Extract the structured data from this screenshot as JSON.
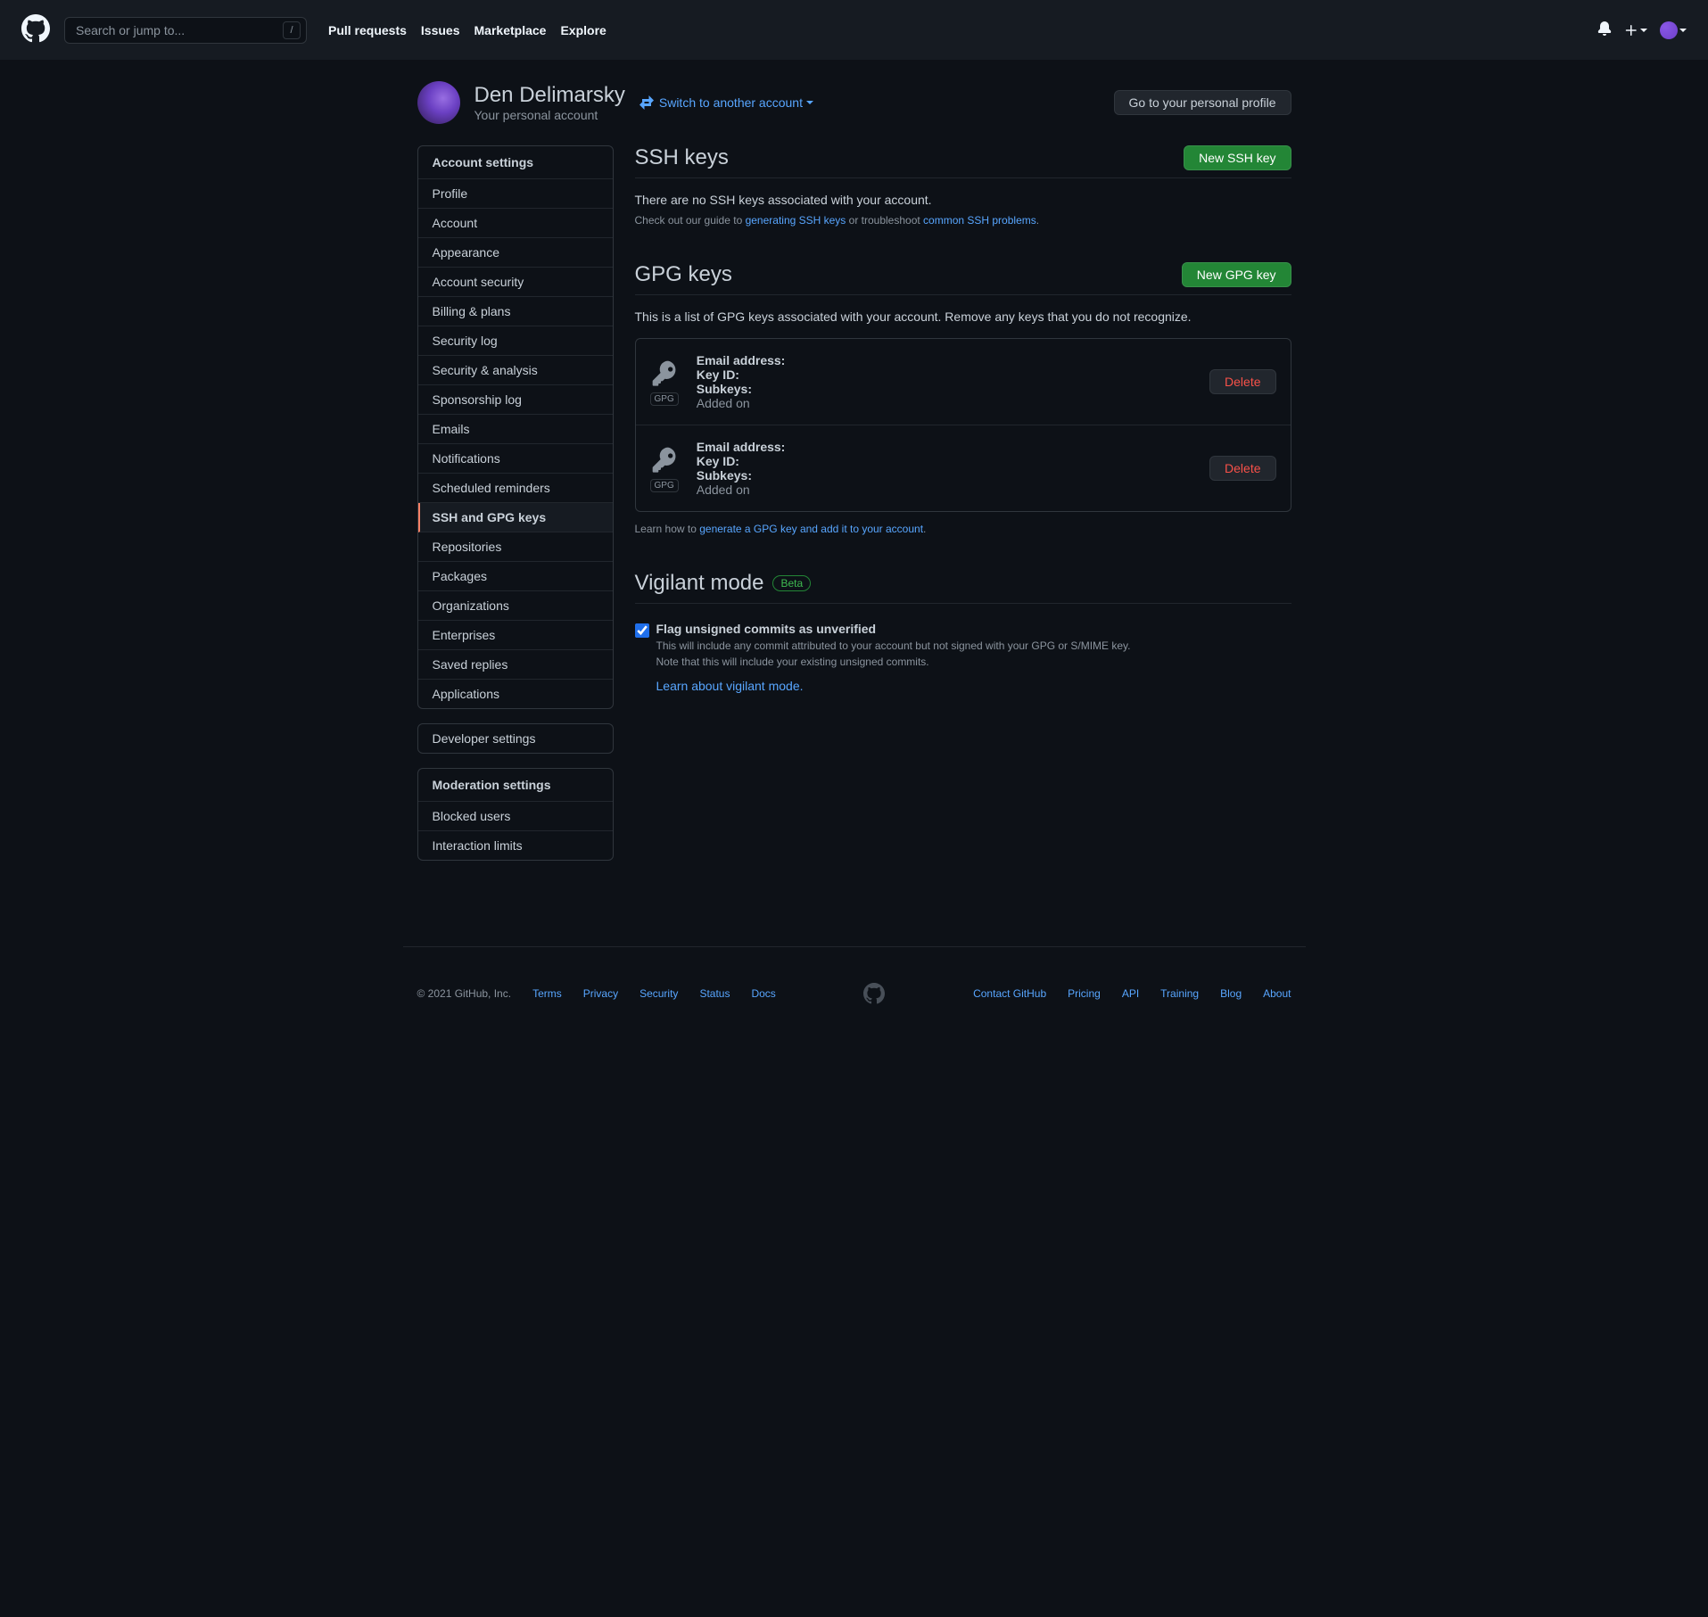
{
  "header": {
    "search_placeholder": "Search or jump to...",
    "nav": [
      "Pull requests",
      "Issues",
      "Marketplace",
      "Explore"
    ]
  },
  "profile": {
    "name": "Den Delimarsky",
    "subtitle": "Your personal account",
    "switch_label": "Switch to another account",
    "goto_label": "Go to your personal profile"
  },
  "sidebar": {
    "account_settings": {
      "heading": "Account settings",
      "items": [
        "Profile",
        "Account",
        "Appearance",
        "Account security",
        "Billing & plans",
        "Security log",
        "Security & analysis",
        "Sponsorship log",
        "Emails",
        "Notifications",
        "Scheduled reminders",
        "SSH and GPG keys",
        "Repositories",
        "Packages",
        "Organizations",
        "Enterprises",
        "Saved replies",
        "Applications"
      ],
      "active_index": 11
    },
    "developer": {
      "label": "Developer settings"
    },
    "moderation": {
      "heading": "Moderation settings",
      "items": [
        "Blocked users",
        "Interaction limits"
      ]
    }
  },
  "ssh": {
    "title": "SSH keys",
    "new_btn": "New SSH key",
    "empty": "There are no SSH keys associated with your account.",
    "guide_prefix": "Check out our guide to ",
    "guide_link": "generating SSH keys",
    "guide_middle": " or troubleshoot ",
    "trouble_link": "common SSH problems",
    "guide_suffix": "."
  },
  "gpg": {
    "title": "GPG keys",
    "new_btn": "New GPG key",
    "intro": "This is a list of GPG keys associated with your account. Remove any keys that you do not recognize.",
    "badge": "GPG",
    "fields": {
      "email": "Email address:",
      "keyid": "Key ID:",
      "subkeys": "Subkeys:",
      "added": "Added on"
    },
    "delete_btn": "Delete",
    "learn_prefix": "Learn how to ",
    "learn_link": "generate a GPG key and add it to your account",
    "learn_suffix": "."
  },
  "vigilant": {
    "title": "Vigilant mode",
    "beta": "Beta",
    "flag_label": "Flag unsigned commits as unverified",
    "desc1": "This will include any commit attributed to your account but not signed with your GPG or S/MIME key.",
    "desc2": "Note that this will include your existing unsigned commits.",
    "learn_link": "Learn about vigilant mode."
  },
  "footer": {
    "copyright": "© 2021 GitHub, Inc.",
    "left": [
      "Terms",
      "Privacy",
      "Security",
      "Status",
      "Docs"
    ],
    "right": [
      "Contact GitHub",
      "Pricing",
      "API",
      "Training",
      "Blog",
      "About"
    ]
  }
}
